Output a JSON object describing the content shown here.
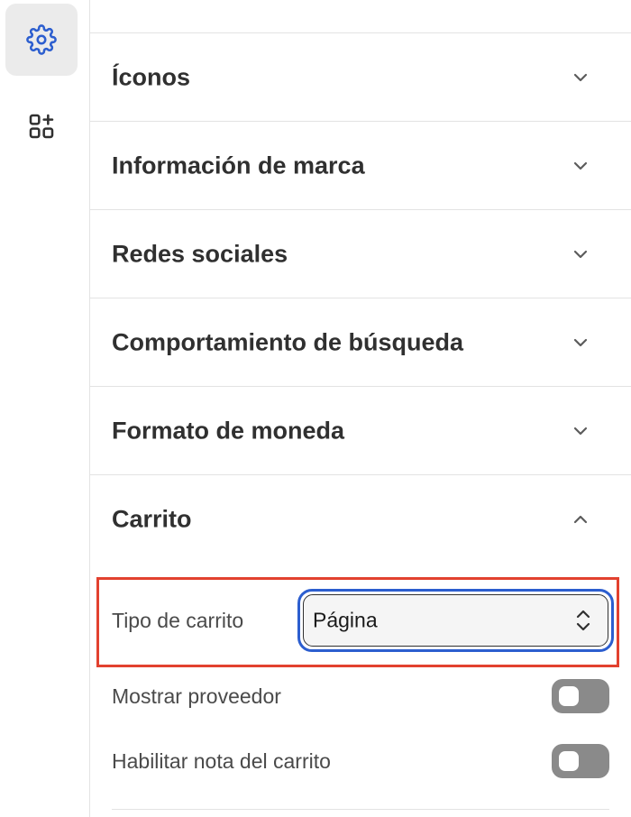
{
  "rail": {
    "items": [
      {
        "icon": "settings-gear-icon",
        "active": true
      },
      {
        "icon": "apps-add-icon",
        "active": false
      }
    ]
  },
  "sections": [
    {
      "title": "Íconos",
      "expanded": false
    },
    {
      "title": "Información de marca",
      "expanded": false
    },
    {
      "title": "Redes sociales",
      "expanded": false
    },
    {
      "title": "Comportamiento de búsqueda",
      "expanded": false
    },
    {
      "title": "Formato de moneda",
      "expanded": false
    },
    {
      "title": "Carrito",
      "expanded": true
    }
  ],
  "cart": {
    "cart_type_label": "Tipo de carrito",
    "cart_type_value": "Página",
    "show_vendor_label": "Mostrar proveedor",
    "show_vendor_enabled": false,
    "cart_note_label": "Habilitar nota del carrito",
    "cart_note_enabled": false
  },
  "colors": {
    "accent": "#2c5ecf",
    "highlight": "#e2412f",
    "toggle_off": "#8a8a8a"
  }
}
